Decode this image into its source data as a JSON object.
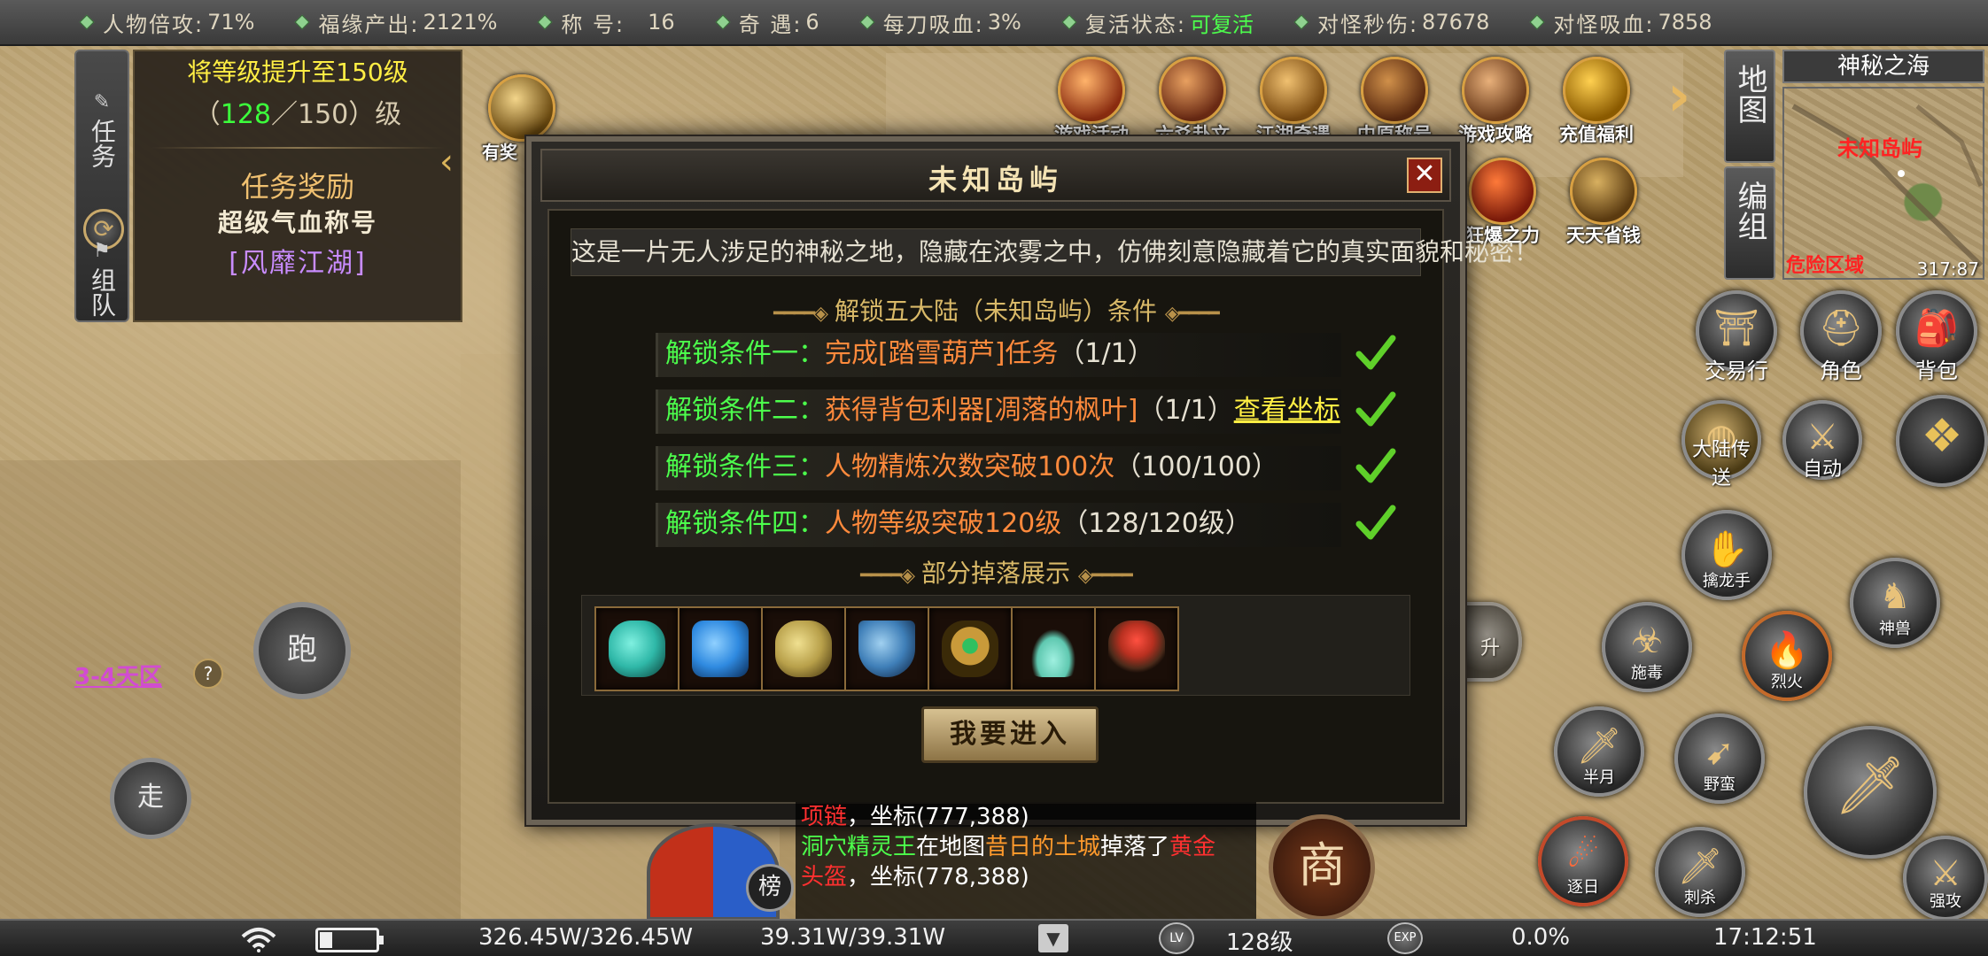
{
  "top_stats": [
    {
      "label": "人物倍攻:",
      "value": "71%"
    },
    {
      "label": "福缘产出:",
      "value": "2121%"
    },
    {
      "label": "称 号:",
      "value": "16"
    },
    {
      "label": "奇 遇:",
      "value": "6"
    },
    {
      "label": "每刀吸血:",
      "value": "3%"
    },
    {
      "label": "复活状态:",
      "value": "可复活",
      "highlight": true
    },
    {
      "label": "对怪秒伤:",
      "value": "87678"
    },
    {
      "label": "对怪吸血:",
      "value": "7858"
    }
  ],
  "quest": {
    "tab_task": "任务",
    "tab_team": "组队",
    "goal": "将等级提升至150级",
    "level_open": "（",
    "level_current": "128",
    "level_rest": "／150）级",
    "reward_title": "任务奖励",
    "reward_sub": "超级气血称号",
    "reward_name": "[风靡江湖]"
  },
  "mini_event_label": "有奖",
  "top_icons": [
    {
      "label": "游戏活动"
    },
    {
      "label": "六爻卦文"
    },
    {
      "label": "江湖奇遇"
    },
    {
      "label": "中原称号"
    },
    {
      "label": "游戏攻略"
    },
    {
      "label": "充值福利"
    },
    {
      "label": "狂爆之力"
    },
    {
      "label": "天天省钱"
    }
  ],
  "side_tabs": {
    "map": "地图",
    "team": "编组"
  },
  "minimap": {
    "title": "神秘之海",
    "place": "未知岛屿",
    "zone": "危险区域",
    "coord": "317:87"
  },
  "right_buttons": {
    "trade": "交易行",
    "role": "角色",
    "bag": "背包",
    "teleport": "大陆传送",
    "auto": "自动"
  },
  "skills": [
    {
      "label": "擒龙手"
    },
    {
      "label": "神兽"
    },
    {
      "label": "施毒"
    },
    {
      "label": "烈火"
    },
    {
      "label": "半月"
    },
    {
      "label": "野蛮"
    },
    {
      "label": "逐日"
    },
    {
      "label": "刺杀"
    },
    {
      "label": "强攻"
    },
    {
      "label": "升"
    }
  ],
  "dialog": {
    "title": "未知岛屿",
    "close": "✕",
    "description": "这是一片无人涉足的神秘之地，隐藏在浓雾之中，仿佛刻意隐藏着它的真实面貌和秘密！",
    "conditions_title": "解锁五大陆（未知岛屿）条件",
    "conditions": [
      {
        "key": "解锁条件一：",
        "value": "完成[踏雪葫芦]任务",
        "progress": "（1/1）",
        "link": ""
      },
      {
        "key": "解锁条件二：",
        "value": "获得背包利器[凋落的枫叶]",
        "progress": "（1/1）",
        "link": "查看坐标"
      },
      {
        "key": "解锁条件三：",
        "value": "人物精炼次数突破100次",
        "progress": "（100/100）",
        "link": ""
      },
      {
        "key": "解锁条件四：",
        "value": "人物等级突破120级",
        "progress": "（128/120级）",
        "link": ""
      }
    ],
    "drops_title": "部分掉落展示",
    "drops": [
      {
        "name": "jade-gourd-icon",
        "color": "#2fb8a8"
      },
      {
        "name": "blue-crystal-icon",
        "color": "#2f8ae0"
      },
      {
        "name": "golden-dragon-icon",
        "color": "#b8a04a"
      },
      {
        "name": "blue-crown-icon",
        "color": "#3f7fb8"
      },
      {
        "name": "emerald-ring-icon",
        "color": "#c99a3a"
      },
      {
        "name": "jade-vase-icon",
        "color": "#5fc8b0"
      },
      {
        "name": "red-pot-icon",
        "color": "#b83020"
      }
    ],
    "enter_button": "我要进入"
  },
  "controls": {
    "run": "跑",
    "walk": "走",
    "zone_label": "3-4天区",
    "help": "?"
  },
  "chat": {
    "line1_a": "项链",
    "line1_b": "，坐标(777,388)",
    "line2_a": "洞穴精灵王",
    "line2_b": "在地图",
    "line2_c": "昔日的土城",
    "line2_d": "掉落了",
    "line2_e": "黄金",
    "line3_a": "头盔",
    "line3_b": "，坐标(778,388)"
  },
  "rank_label": "榜",
  "shop_label": "商",
  "bottom": {
    "hp": "326.45W/326.45W",
    "mp": "39.31W/39.31W",
    "lv_badge": "LV",
    "level": "128级",
    "exp_badge": "EXP",
    "exp": "0.0%",
    "time": "17:12:51"
  },
  "colors": {
    "green": "#4cff4c",
    "orange": "#ff8a3c",
    "yellow": "#ffee44",
    "purple": "#c98cff",
    "red": "#ff2222"
  }
}
